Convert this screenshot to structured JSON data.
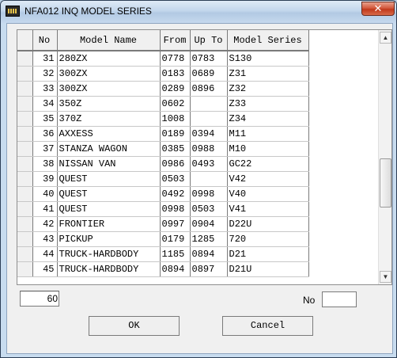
{
  "window": {
    "title": "NFA012  INQ MODEL SERIES",
    "close_glyph": "✕"
  },
  "grid": {
    "columns": [
      "No",
      "Model Name",
      "From",
      "Up To",
      "Model Series"
    ],
    "rows": [
      {
        "no": "31",
        "name": "280ZX",
        "from": "0778",
        "upto": "0783",
        "series": "S130"
      },
      {
        "no": "32",
        "name": "300ZX",
        "from": "0183",
        "upto": "0689",
        "series": "Z31"
      },
      {
        "no": "33",
        "name": "300ZX",
        "from": "0289",
        "upto": "0896",
        "series": "Z32"
      },
      {
        "no": "34",
        "name": "350Z",
        "from": "0602",
        "upto": "",
        "series": "Z33"
      },
      {
        "no": "35",
        "name": "370Z",
        "from": "1008",
        "upto": "",
        "series": "Z34"
      },
      {
        "no": "36",
        "name": "AXXESS",
        "from": "0189",
        "upto": "0394",
        "series": "M11"
      },
      {
        "no": "37",
        "name": "STANZA WAGON",
        "from": "0385",
        "upto": "0988",
        "series": "M10"
      },
      {
        "no": "38",
        "name": "NISSAN VAN",
        "from": "0986",
        "upto": "0493",
        "series": "GC22"
      },
      {
        "no": "39",
        "name": "QUEST",
        "from": "0503",
        "upto": "",
        "series": "V42"
      },
      {
        "no": "40",
        "name": "QUEST",
        "from": "0492",
        "upto": "0998",
        "series": "V40"
      },
      {
        "no": "41",
        "name": "QUEST",
        "from": "0998",
        "upto": "0503",
        "series": "V41"
      },
      {
        "no": "42",
        "name": "FRONTIER",
        "from": "0997",
        "upto": "0904",
        "series": "D22U"
      },
      {
        "no": "43",
        "name": "PICKUP",
        "from": "0179",
        "upto": "1285",
        "series": "720"
      },
      {
        "no": "44",
        "name": "TRUCK-HARDBODY",
        "from": "1185",
        "upto": "0894",
        "series": "D21"
      },
      {
        "no": "45",
        "name": "TRUCK-HARDBODY",
        "from": "0894",
        "upto": "0897",
        "series": "D21U"
      }
    ]
  },
  "scrollbar": {
    "up_glyph": "▲",
    "down_glyph": "▼"
  },
  "footer": {
    "count_value": "60",
    "no_label": "No",
    "no_value": "",
    "ok_label": "OK",
    "cancel_label": "Cancel"
  }
}
